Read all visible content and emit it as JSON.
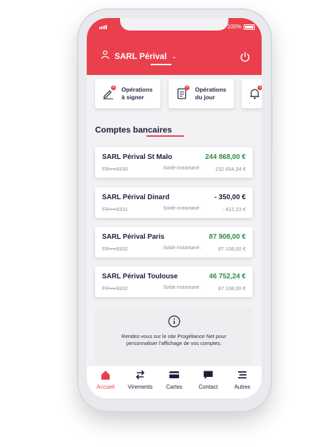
{
  "status_bar": {
    "battery": "100%"
  },
  "header": {
    "user_name": "SARL Périval",
    "caret": "⌄"
  },
  "quick_actions": [
    {
      "label_line1": "Opérations",
      "label_line2": "à signer",
      "badge": "6"
    },
    {
      "label_line1": "Opérations",
      "label_line2": "du jour",
      "badge": "3"
    },
    {
      "label_line1": "",
      "label_line2": "",
      "badge": "1"
    }
  ],
  "section": {
    "title": "Comptes bancaires"
  },
  "accounts": [
    {
      "name": "SARL Périval St Malo",
      "amount": "244 868,00 €",
      "account": "FR••••9330",
      "solde_label": "Solde instantané :",
      "instant": "232 654,54 €",
      "positive": true
    },
    {
      "name": "SARL Périval Dinard",
      "amount": "- 350,00 €",
      "account": "FR••••9331",
      "solde_label": "Solde instantané :",
      "instant": "- 412,23 €",
      "positive": false
    },
    {
      "name": "SARL Périval Paris",
      "amount": "87 908,00 €",
      "account": "FR••••9332",
      "solde_label": "Solde instantané :",
      "instant": "87 108,00 €",
      "positive": true
    },
    {
      "name": "SARL Périval Toulouse",
      "amount": "46 752,24 €",
      "account": "FR••••9332",
      "solde_label": "Solde instantané :",
      "instant": "87 108,00 €",
      "positive": true
    }
  ],
  "info": {
    "line1": "Rendez-vous sur le site Progéliance Net pour",
    "line2": "personnaliser l'affichage de vos comptes."
  },
  "tabs": [
    {
      "label": "Accueil",
      "icon": "home-icon",
      "active": true
    },
    {
      "label": "Virements",
      "icon": "transfer-icon",
      "active": false
    },
    {
      "label": "Cartes",
      "icon": "card-icon",
      "active": false
    },
    {
      "label": "Contact",
      "icon": "chat-icon",
      "active": false
    },
    {
      "label": "Autres",
      "icon": "menu-icon",
      "active": false
    }
  ],
  "colors": {
    "brand_red": "#ea3f4d",
    "positive_green": "#2e8b3e",
    "text_dark": "#1b1d3a"
  }
}
